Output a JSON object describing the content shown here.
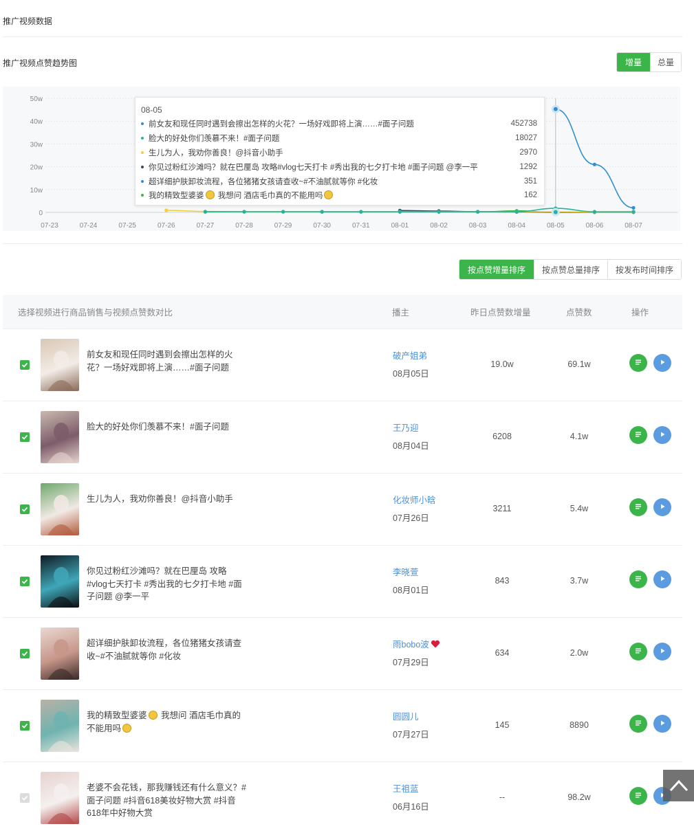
{
  "page": {
    "title": "推广视频数据"
  },
  "chart_section": {
    "title": "推广视频点赞趋势图",
    "toggle": [
      "增量",
      "总量"
    ],
    "active_toggle": 0
  },
  "chart_data": {
    "type": "line",
    "x": [
      "07-23",
      "07-24",
      "07-25",
      "07-26",
      "07-27",
      "07-28",
      "07-29",
      "07-30",
      "07-31",
      "08-01",
      "08-02",
      "08-03",
      "08-04",
      "08-05",
      "08-06",
      "08-07"
    ],
    "y_ticks": [
      "0",
      "10w",
      "20w",
      "30w",
      "40w",
      "50w"
    ],
    "ylim": [
      0,
      500000
    ],
    "series": [
      {
        "name": "前女友和现任同时遇到会擦出怎样的火花？一场好戏即将上演……#面子问题",
        "color": "#2f8fd1",
        "values": [
          null,
          null,
          null,
          null,
          null,
          null,
          null,
          null,
          null,
          null,
          null,
          null,
          null,
          452738,
          210000,
          20000
        ]
      },
      {
        "name": "脸大的好处你们羡慕不来！#面子问题",
        "color": "#25b39e",
        "values": [
          null,
          null,
          null,
          null,
          3000,
          3000,
          3000,
          3000,
          3000,
          3000,
          3000,
          3000,
          3000,
          18027,
          3000,
          3000
        ]
      },
      {
        "name": "生儿为人，我劝你善良！@抖音小助手",
        "color": "#f3d03e",
        "values": [
          null,
          null,
          null,
          9000,
          4000,
          3000,
          3000,
          3000,
          3000,
          3000,
          3000,
          3000,
          3000,
          2970,
          2000,
          2000
        ]
      },
      {
        "name": "你见过粉红沙滩吗？就在巴厘岛 攻略#vlog七天打卡 #秀出我的七夕打卡地 #面子问题 @李一平",
        "color": "#34495e",
        "values": [
          null,
          null,
          null,
          null,
          null,
          null,
          null,
          null,
          null,
          8000,
          6000,
          3000,
          2000,
          1292,
          1000,
          1000
        ]
      },
      {
        "name": "超详细护肤卸妆流程，各位猪猪女孩请查收~#不油腻就等你 #化妆",
        "color": "#2f8fd1",
        "values": [
          null,
          null,
          null,
          null,
          null,
          null,
          null,
          2000,
          2000,
          2000,
          2000,
          2000,
          2000,
          351,
          1000,
          1000
        ]
      },
      {
        "name": "我的精致型婆婆🙄 我想问 酒店毛巾真的不能用吗😕",
        "color": "#3bb54a",
        "values": [
          null,
          null,
          null,
          null,
          2000,
          2000,
          2000,
          2000,
          2000,
          2000,
          2000,
          2000,
          7000,
          162,
          1000,
          1000
        ]
      }
    ],
    "tooltip": {
      "date": "08-05",
      "rows": [
        {
          "label": "前女友和现任同时遇到会擦出怎样的火花？一场好戏即将上演……#面子问题",
          "value": "452738",
          "color": "#2f8fd1"
        },
        {
          "label": "脸大的好处你们羡慕不来！#面子问题",
          "value": "18027",
          "color": "#25b39e"
        },
        {
          "label": "生儿为人，我劝你善良！@抖音小助手",
          "value": "2970",
          "color": "#f3d03e"
        },
        {
          "label": "你见过粉红沙滩吗？就在巴厘岛 攻略#vlog七天打卡 #秀出我的七夕打卡地 #面子问题 @李一平",
          "value": "1292",
          "color": "#34495e"
        },
        {
          "label": "超详细护肤卸妆流程，各位猪猪女孩请查收~#不油腻就等你 #化妆",
          "value": "351",
          "color": "#2f8fd1"
        },
        {
          "label_a": "我的精致型婆婆",
          "label_b": "我想问 酒店毛巾真的不能用吗",
          "value": "162",
          "color": "#3bb54a"
        }
      ]
    }
  },
  "sort_buttons": [
    "按点赞增量排序",
    "按点赞总量排序",
    "按发布时间排序"
  ],
  "table": {
    "headers": [
      "选择视频进行商品销售与视频点赞数对比",
      "播主",
      "昨日点赞数增量",
      "点赞数",
      "操作"
    ],
    "rows": [
      {
        "checked": true,
        "title": "前女友和现任同时遇到会擦出怎样的火花？一场好戏即将上演……#面子问题",
        "anchor": "破产姐弟",
        "date": "08月05日",
        "increase": "19.0w",
        "likes": "69.1w",
        "thumb": [
          "#d9c7b4",
          "#f2ece6",
          "#8a6a58"
        ]
      },
      {
        "checked": true,
        "title": "脸大的好处你们羡慕不来！#面子问题",
        "anchor": "王乃迎",
        "date": "08月04日",
        "increase": "6208",
        "likes": "4.1w",
        "thumb": [
          "#c9b9ae",
          "#7d5c6a",
          "#e7d4cf"
        ]
      },
      {
        "checked": true,
        "title": "生儿为人，我劝你善良！@抖音小助手",
        "anchor": "化妆师小晗",
        "date": "07月26日",
        "increase": "3211",
        "likes": "5.4w",
        "thumb": [
          "#6fa86d",
          "#f1e9e4",
          "#b35a3c"
        ]
      },
      {
        "checked": true,
        "title": "你见过粉红沙滩吗？就在巴厘岛 攻略#vlog七天打卡 #秀出我的七夕打卡地 #面子问题 @李一平",
        "anchor": "李晓萱",
        "date": "08月01日",
        "increase": "843",
        "likes": "3.7w",
        "thumb": [
          "#0e1a22",
          "#3fa7b8",
          "#0b0f12"
        ]
      },
      {
        "checked": true,
        "title": "超详细护肤卸妆流程，各位猪猪女孩请查收~#不油腻就等你 #化妆",
        "anchor": "雨bobo波",
        "anchor_heart": true,
        "date": "07月29日",
        "increase": "634",
        "likes": "2.0w",
        "thumb": [
          "#e8d8d2",
          "#c7978a",
          "#3a2a28"
        ]
      },
      {
        "checked": true,
        "title_a": "我的精致型婆婆",
        "title_b": "我想问 酒店毛巾真的不能用吗",
        "anchor": "圆圆儿",
        "date": "07月27日",
        "increase": "145",
        "likes": "8890",
        "thumb": [
          "#b9b2a6",
          "#6fb3b0",
          "#e9e4dc"
        ]
      },
      {
        "checked": false,
        "title": "老婆不会花钱，那我赚钱还有什么意义？#面子问题 #抖音618美妆好物大赏 #抖音618年中好物大赏",
        "anchor": "王祖蓝",
        "date": "06月16日",
        "increase": "--",
        "likes": "98.2w",
        "thumb": [
          "#e6d2cf",
          "#f4f0ee",
          "#b34848"
        ]
      }
    ]
  }
}
